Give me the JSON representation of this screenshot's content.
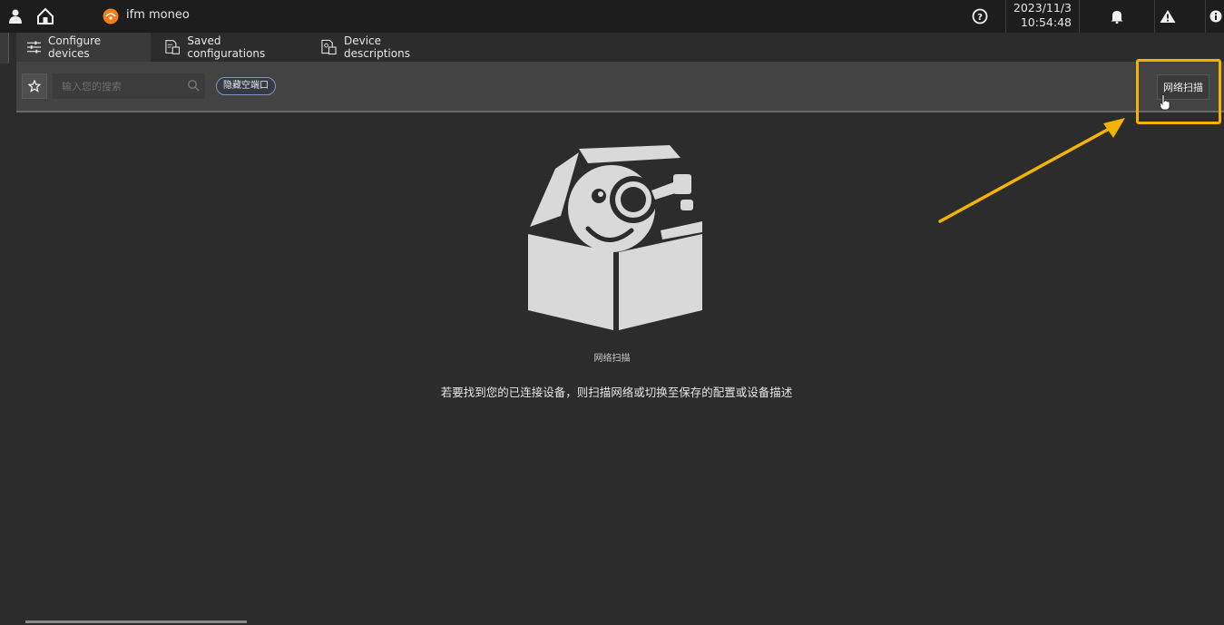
{
  "app": {
    "title": "ifm moneo",
    "date": "2023/11/3",
    "time": "10:54:48"
  },
  "icons": {
    "user": "user-icon",
    "home": "home-icon",
    "logo": "ifm-logo",
    "help": "help-icon",
    "bell": "bell-icon",
    "warning": "warning-icon",
    "info": "info-icon",
    "star": "star-icon",
    "search": "search-icon"
  },
  "tabs": [
    {
      "label": "Configure devices",
      "active": true
    },
    {
      "label": "Saved configurations",
      "active": false
    },
    {
      "label": "Device descriptions",
      "active": false
    }
  ],
  "toolbar": {
    "search_placeholder": "输入您的搜索",
    "hide_chip": "隐藏空端口",
    "scan_button": "网络扫描"
  },
  "empty_state": {
    "title": "网络扫描",
    "description": "若要找到您的已连接设备，则扫描网络或切换至保存的配置或设备描述"
  },
  "colors": {
    "background": "#2c2c2c",
    "topbar": "#1d1d1d",
    "toolbar": "#434343",
    "highlight": "#f2b400",
    "chip_border": "#7f95c7",
    "logo": "#f07d1e"
  }
}
